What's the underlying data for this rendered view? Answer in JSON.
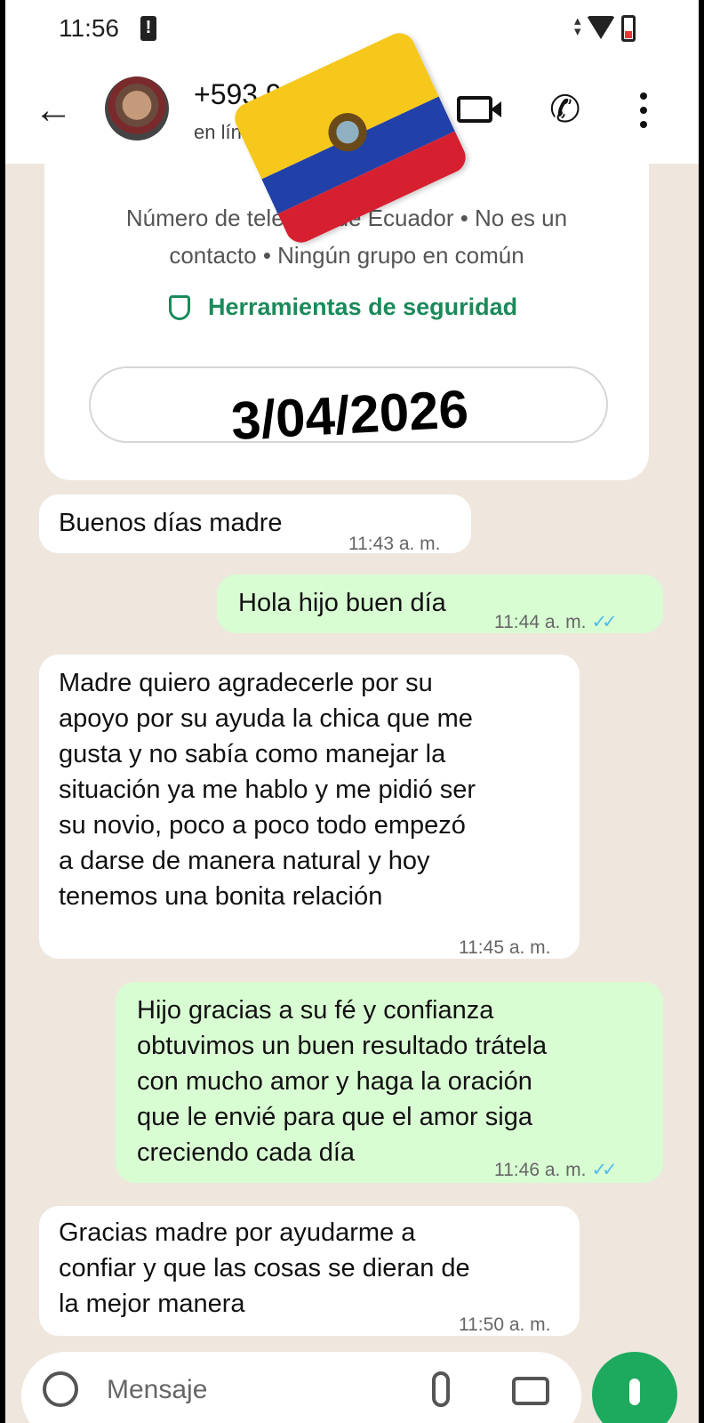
{
  "status_bar": {
    "time": "11:56"
  },
  "header": {
    "contact_number": "+593 99",
    "contact_status": "en línea"
  },
  "info_card": {
    "description": "Número de teléfono de Ecuador • No es un contacto • Ningún grupo en común",
    "security_link": "Herramientas de seguridad",
    "date_overlay": "3/04/2026"
  },
  "messages": [
    {
      "direction": "incoming",
      "text": "Buenos días madre",
      "time": "11:43 a. m."
    },
    {
      "direction": "outgoing",
      "text": "Hola hijo buen día",
      "time": "11:44 a. m.",
      "read": true
    },
    {
      "direction": "incoming",
      "lines": [
        "Madre quiero agradecerle por su",
        "apoyo por su ayuda la chica que me",
        "gusta y no sabía como manejar la",
        "situación ya me hablo y me pidió ser",
        "su novio, poco a poco todo empezó",
        "a darse de manera natural y hoy",
        "tenemos una bonita relación"
      ],
      "time": "11:45 a. m."
    },
    {
      "direction": "outgoing",
      "lines": [
        "Hijo gracias a su fé y confianza",
        "obtuvimos un buen resultado trátela",
        "con mucho amor y haga la oración",
        "que le envié para que el amor siga",
        "creciendo cada día"
      ],
      "time": "11:46 a. m.",
      "read": true
    },
    {
      "direction": "incoming",
      "lines": [
        "Gracias madre por ayudarme a",
        "confiar y que las cosas se dieran de",
        "la mejor manera"
      ],
      "time": "11:50 a. m."
    }
  ],
  "composer": {
    "placeholder": "Mensaje"
  },
  "icons": {
    "read_receipt": "double-check-icon",
    "flag": "ecuador-flag-icon"
  }
}
